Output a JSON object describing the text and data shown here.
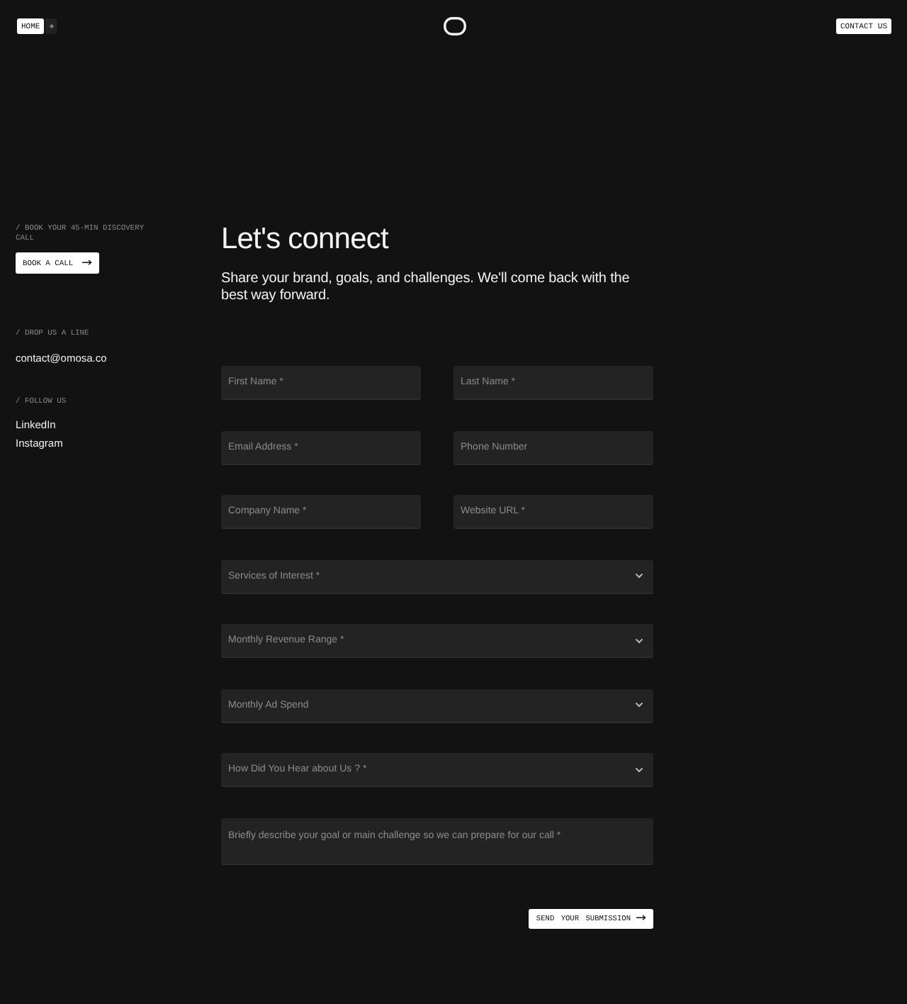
{
  "header": {
    "home_button": "HOME",
    "contact_button": "CONTACT US"
  },
  "sidebar": [
    {
      "heading": "/ BOOK YOUR 45-MIN DISCOVERY CALL",
      "kind": "button",
      "items": [
        "BOOK A CALL"
      ]
    },
    {
      "heading": "/ DROP US A LINE",
      "kind": "links",
      "items": [
        "contact@omosa.co"
      ]
    },
    {
      "heading": "/ FOLLOW US",
      "kind": "links",
      "items": [
        "LinkedIn",
        "Instagram"
      ]
    }
  ],
  "main": {
    "title": "Let's connect",
    "subtitle": "Share your brand, goals, and challenges. We'll come back with the best way forward."
  },
  "form": {
    "rows": [
      {
        "fields": [
          {
            "kind": "input",
            "placeholder": "First Name *"
          },
          {
            "kind": "input",
            "placeholder": "Last Name *"
          }
        ]
      },
      {
        "fields": [
          {
            "kind": "input",
            "placeholder": "Email Address *"
          },
          {
            "kind": "input",
            "placeholder": "Phone Number"
          }
        ]
      },
      {
        "fields": [
          {
            "kind": "input",
            "placeholder": "Company Name *"
          },
          {
            "kind": "input",
            "placeholder": "Website URL *"
          }
        ]
      },
      {
        "fields": [
          {
            "kind": "select",
            "placeholder": "Services of Interest *"
          }
        ]
      },
      {
        "fields": [
          {
            "kind": "select",
            "placeholder": "Monthly Revenue Range *"
          }
        ]
      },
      {
        "fields": [
          {
            "kind": "select",
            "placeholder": "Monthly Ad Spend"
          }
        ]
      },
      {
        "fields": [
          {
            "kind": "select",
            "placeholder": "How Did You Hear about Us ? *"
          }
        ]
      },
      {
        "fields": [
          {
            "kind": "textarea",
            "placeholder": "Briefly describe your goal or main challenge so we can prepare for our call *"
          }
        ]
      }
    ],
    "submit": "SEND YOUR SUBMISSION"
  }
}
